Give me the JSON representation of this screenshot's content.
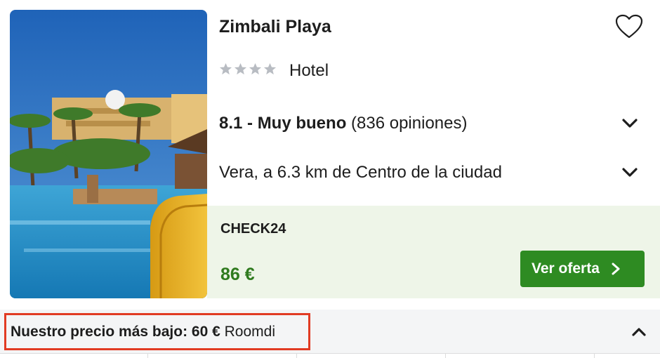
{
  "hotel": {
    "name": "Zimbali Playa",
    "star_rating": 4,
    "type": "Hotel",
    "rating_score_label": "8.1 - Muy bueno",
    "rating_reviews": "(836 opiniones)",
    "location": "Vera, a 6.3 km de Centro de la ciudad",
    "photo_icon": "hotel-photo"
  },
  "offer": {
    "provider": "CHECK24",
    "price": "86 €",
    "button_label": "Ver oferta"
  },
  "lowest_price": {
    "label": "Nuestro precio más bajo:",
    "price": "60 €",
    "provider": "Roomdi"
  },
  "icons": {
    "favorite": "heart-icon",
    "expand": "chevron-down-icon",
    "collapse": "chevron-up-icon",
    "button_arrow": "chevron-right-icon"
  },
  "colors": {
    "offer_panel_bg": "#eef5e8",
    "offer_price": "#2f7a1e",
    "offer_button": "#2e8b22",
    "highlight_border": "#e13b23",
    "star_gray": "#b8bcc2"
  }
}
